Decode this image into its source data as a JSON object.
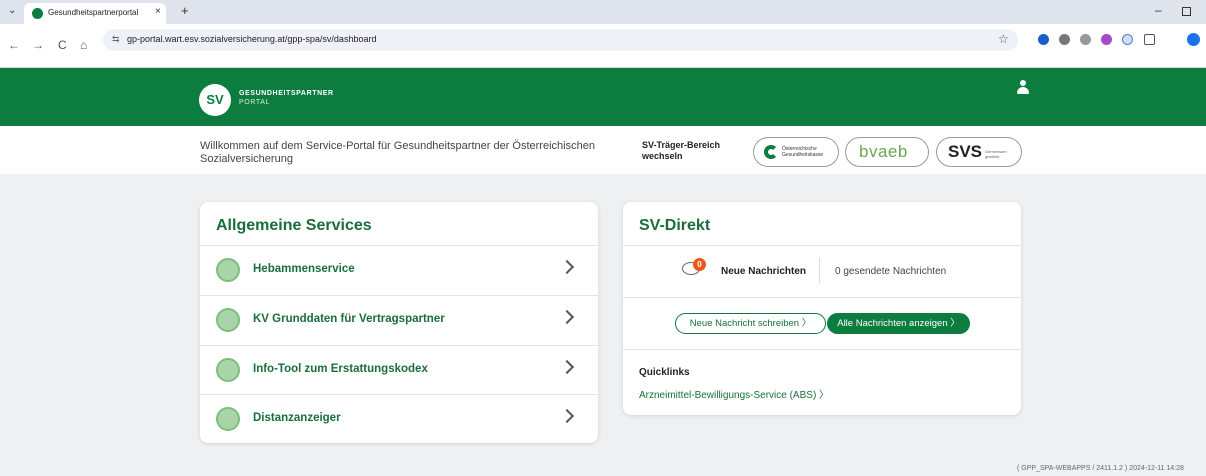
{
  "browser": {
    "tab_title": "Gesundheitspartnerportal",
    "tab_close": "×",
    "tab_new": "+",
    "tab_list": "⌄",
    "url": "gp-portal.wart.esv.sozialversicherung.at/gpp-spa/sv/dashboard",
    "site_info_glyph": "⇆",
    "bookmark_glyph": "☆",
    "back_glyph": "←",
    "forward_glyph": "→",
    "reload_glyph": "C",
    "home_glyph": "⌂",
    "minimize_glyph": "–"
  },
  "header": {
    "logo_initials": "SV",
    "logo_line1": "GESUNDHEITSPARTNER",
    "logo_line2": "PORTAL"
  },
  "welcome": {
    "text": "Willkommen auf dem Service-Portal für Gesundheitspartner der Österreichischen Sozialversicherung",
    "traeger_label": "SV-Träger-Bereich wechseln",
    "oegk_text": "Österreichische Gesundheitskasse",
    "bvaeb_text": "bvaeb",
    "svs_text": "SVS",
    "svs_sub": "Gemeinsam gestärkt."
  },
  "services": {
    "title": "Allgemeine Services",
    "items": [
      {
        "label": "Hebammenservice"
      },
      {
        "label": "KV Grunddaten für Vertragspartner"
      },
      {
        "label": "Info-Tool zum Erstattungskodex"
      },
      {
        "label": "Distanzanzeiger"
      }
    ]
  },
  "svdirekt": {
    "title": "SV-Direkt",
    "badge_count": "0",
    "neue_label": "Neue Nachrichten",
    "gesendet_label": "0 gesendete Nachrichten",
    "btn_new": "Neue Nachricht schreiben  〉",
    "btn_all": "Alle Nachrichten anzeigen  〉",
    "quicklinks_title": "Quicklinks",
    "quicklink": "Arzneimittel-Bewilligungs-Service (ABS)  〉"
  },
  "footer": {
    "version": "( GPP_SPA-WEBAPPS / 2411.1.2 ) 2024-12-11 14:28"
  },
  "colors": {
    "brand_green": "#0c7d3f",
    "title_green": "#1a6e3a",
    "badge_orange": "#e9591b"
  }
}
